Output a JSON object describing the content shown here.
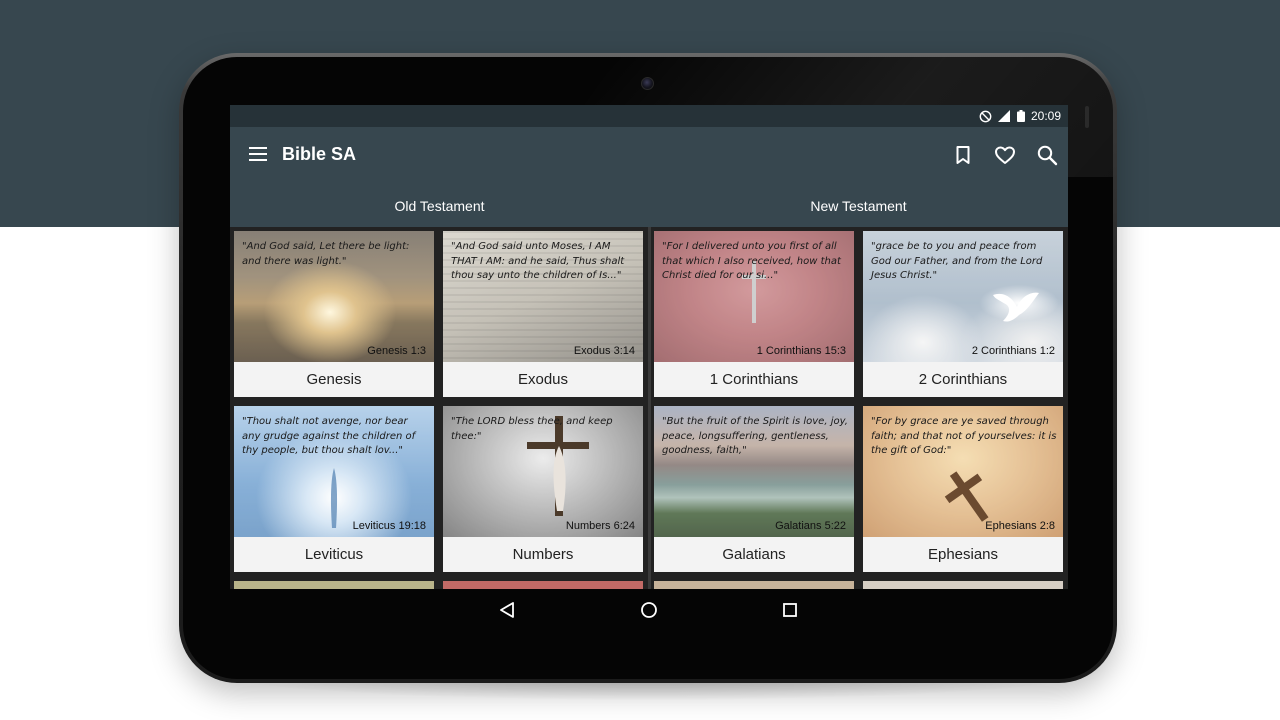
{
  "status_bar": {
    "time": "20:09"
  },
  "app_bar": {
    "title": "Bible SA"
  },
  "tabs": [
    {
      "label": "Old Testament"
    },
    {
      "label": "New Testament"
    }
  ],
  "books": [
    {
      "name": "Genesis",
      "quote": "\"And God said, Let there be light: and there was light.\"",
      "ref": "Genesis 1:3"
    },
    {
      "name": "Exodus",
      "quote": "\"And God said unto Moses, I AM THAT I AM: and he said, Thus shalt thou say unto the children of Is...\"",
      "ref": "Exodus 3:14"
    },
    {
      "name": "1 Corinthians",
      "quote": "\"For I delivered unto you first of all that which I also received, how that Christ died for our si...\"",
      "ref": "1 Corinthians 15:3"
    },
    {
      "name": "2 Corinthians",
      "quote": "\"grace be to you and peace from God our Father, and from the Lord Jesus Christ.\"",
      "ref": "2 Corinthians 1:2"
    },
    {
      "name": "Leviticus",
      "quote": "\"Thou shalt not avenge, nor bear any grudge against the children of thy people, but thou shalt lov...\"",
      "ref": "Leviticus 19:18"
    },
    {
      "name": "Numbers",
      "quote": "\"The LORD bless thee, and keep thee:\"",
      "ref": "Numbers 6:24"
    },
    {
      "name": "Galatians",
      "quote": "\"But the fruit of the Spirit is love, joy, peace, longsuffering, gentleness, goodness, faith,\"",
      "ref": "Galatians 5:22"
    },
    {
      "name": "Ephesians",
      "quote": "\"For by grace are ye saved through faith; and that not of yourselves: it is the gift of God:\"",
      "ref": "Ephesians 2:8"
    }
  ],
  "icons": {
    "menu": "menu-icon",
    "bookmark": "bookmark-icon",
    "favorite": "heart-icon",
    "search": "search-icon",
    "nav_back": "back-triangle-icon",
    "nav_home": "home-circle-icon",
    "nav_recents": "recents-square-icon"
  },
  "colors": {
    "app_bar": "#37474f",
    "status_bar": "#263238",
    "card_label_bg": "#f3f3f3"
  }
}
